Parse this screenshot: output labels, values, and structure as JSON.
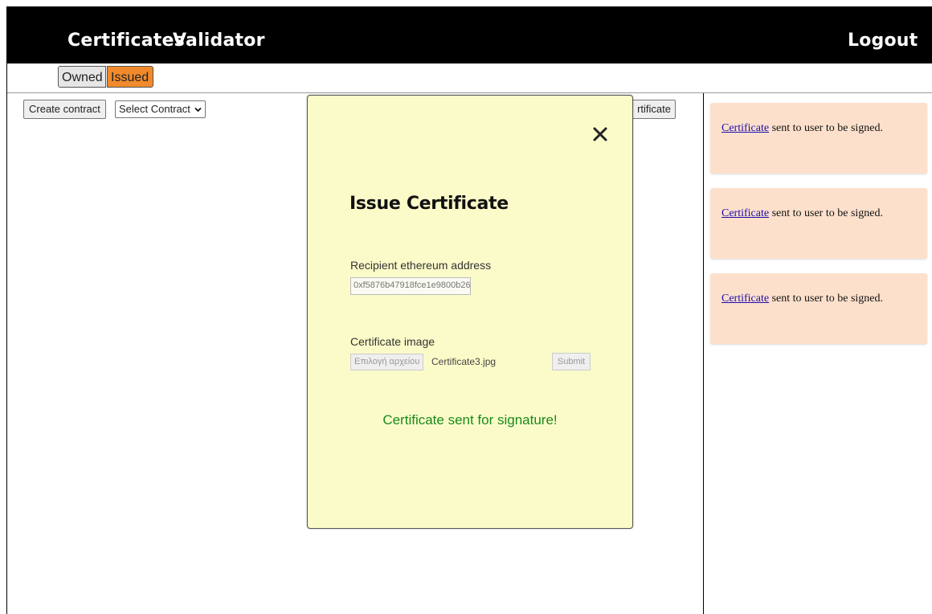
{
  "navbar": {
    "certificates_label": "Certificates",
    "validator_label": "Validator",
    "logout_label": "Logout"
  },
  "tabs": [
    {
      "label": "Owned",
      "active": false
    },
    {
      "label": "Issued",
      "active": true
    }
  ],
  "toolbar": {
    "create_contract_label": "Create contract",
    "select_contract_label": "Select Contract",
    "issue_certificate_label": "rtificate"
  },
  "modal": {
    "title": "Issue Certificate",
    "recipient_label": "Recipient ethereum address",
    "recipient_value": "0xf5876b47918fce1e9800b26",
    "image_label": "Certificate image",
    "file_button_label": "Επιλογή αρχείου",
    "file_name": "Certificate3.jpg",
    "submit_label": "Submit",
    "success_message": "Certificate sent for signature!"
  },
  "notifications": [
    {
      "link_text": "Certificate",
      "message": " sent to user to be signed."
    },
    {
      "link_text": "Certificate",
      "message": " sent to user to be signed."
    },
    {
      "link_text": "Certificate",
      "message": " sent to user to be signed."
    }
  ],
  "colors": {
    "navbar_bg": "#000000",
    "issued_tab": "#f08a2c",
    "modal_bg": "#fbfbc9",
    "notification_bg": "#fde0cc",
    "success_text": "#1a8a1a"
  }
}
